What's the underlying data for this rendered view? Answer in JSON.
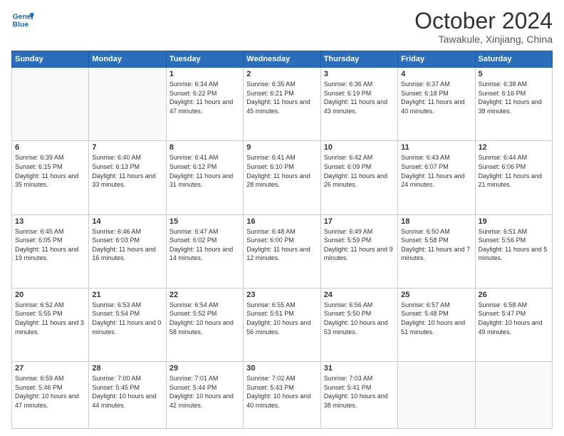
{
  "logo": {
    "line1": "General",
    "line2": "Blue"
  },
  "title": "October 2024",
  "subtitle": "Tawakule, Xinjiang, China",
  "weekdays": [
    "Sunday",
    "Monday",
    "Tuesday",
    "Wednesday",
    "Thursday",
    "Friday",
    "Saturday"
  ],
  "weeks": [
    [
      {
        "day": "",
        "info": ""
      },
      {
        "day": "",
        "info": ""
      },
      {
        "day": "1",
        "info": "Sunrise: 6:34 AM\nSunset: 6:22 PM\nDaylight: 11 hours and 47 minutes."
      },
      {
        "day": "2",
        "info": "Sunrise: 6:35 AM\nSunset: 6:21 PM\nDaylight: 11 hours and 45 minutes."
      },
      {
        "day": "3",
        "info": "Sunrise: 6:36 AM\nSunset: 6:19 PM\nDaylight: 11 hours and 43 minutes."
      },
      {
        "day": "4",
        "info": "Sunrise: 6:37 AM\nSunset: 6:18 PM\nDaylight: 11 hours and 40 minutes."
      },
      {
        "day": "5",
        "info": "Sunrise: 6:38 AM\nSunset: 6:16 PM\nDaylight: 11 hours and 38 minutes."
      }
    ],
    [
      {
        "day": "6",
        "info": "Sunrise: 6:39 AM\nSunset: 6:15 PM\nDaylight: 11 hours and 35 minutes."
      },
      {
        "day": "7",
        "info": "Sunrise: 6:40 AM\nSunset: 6:13 PM\nDaylight: 11 hours and 33 minutes."
      },
      {
        "day": "8",
        "info": "Sunrise: 6:41 AM\nSunset: 6:12 PM\nDaylight: 11 hours and 31 minutes."
      },
      {
        "day": "9",
        "info": "Sunrise: 6:41 AM\nSunset: 6:10 PM\nDaylight: 11 hours and 28 minutes."
      },
      {
        "day": "10",
        "info": "Sunrise: 6:42 AM\nSunset: 6:09 PM\nDaylight: 11 hours and 26 minutes."
      },
      {
        "day": "11",
        "info": "Sunrise: 6:43 AM\nSunset: 6:07 PM\nDaylight: 11 hours and 24 minutes."
      },
      {
        "day": "12",
        "info": "Sunrise: 6:44 AM\nSunset: 6:06 PM\nDaylight: 11 hours and 21 minutes."
      }
    ],
    [
      {
        "day": "13",
        "info": "Sunrise: 6:45 AM\nSunset: 6:05 PM\nDaylight: 11 hours and 19 minutes."
      },
      {
        "day": "14",
        "info": "Sunrise: 6:46 AM\nSunset: 6:03 PM\nDaylight: 11 hours and 16 minutes."
      },
      {
        "day": "15",
        "info": "Sunrise: 6:47 AM\nSunset: 6:02 PM\nDaylight: 11 hours and 14 minutes."
      },
      {
        "day": "16",
        "info": "Sunrise: 6:48 AM\nSunset: 6:00 PM\nDaylight: 11 hours and 12 minutes."
      },
      {
        "day": "17",
        "info": "Sunrise: 6:49 AM\nSunset: 5:59 PM\nDaylight: 11 hours and 9 minutes."
      },
      {
        "day": "18",
        "info": "Sunrise: 6:50 AM\nSunset: 5:58 PM\nDaylight: 11 hours and 7 minutes."
      },
      {
        "day": "19",
        "info": "Sunrise: 6:51 AM\nSunset: 5:56 PM\nDaylight: 11 hours and 5 minutes."
      }
    ],
    [
      {
        "day": "20",
        "info": "Sunrise: 6:52 AM\nSunset: 5:55 PM\nDaylight: 11 hours and 3 minutes."
      },
      {
        "day": "21",
        "info": "Sunrise: 6:53 AM\nSunset: 5:54 PM\nDaylight: 11 hours and 0 minutes."
      },
      {
        "day": "22",
        "info": "Sunrise: 6:54 AM\nSunset: 5:52 PM\nDaylight: 10 hours and 58 minutes."
      },
      {
        "day": "23",
        "info": "Sunrise: 6:55 AM\nSunset: 5:51 PM\nDaylight: 10 hours and 56 minutes."
      },
      {
        "day": "24",
        "info": "Sunrise: 6:56 AM\nSunset: 5:50 PM\nDaylight: 10 hours and 53 minutes."
      },
      {
        "day": "25",
        "info": "Sunrise: 6:57 AM\nSunset: 5:48 PM\nDaylight: 10 hours and 51 minutes."
      },
      {
        "day": "26",
        "info": "Sunrise: 6:58 AM\nSunset: 5:47 PM\nDaylight: 10 hours and 49 minutes."
      }
    ],
    [
      {
        "day": "27",
        "info": "Sunrise: 6:59 AM\nSunset: 5:46 PM\nDaylight: 10 hours and 47 minutes."
      },
      {
        "day": "28",
        "info": "Sunrise: 7:00 AM\nSunset: 5:45 PM\nDaylight: 10 hours and 44 minutes."
      },
      {
        "day": "29",
        "info": "Sunrise: 7:01 AM\nSunset: 5:44 PM\nDaylight: 10 hours and 42 minutes."
      },
      {
        "day": "30",
        "info": "Sunrise: 7:02 AM\nSunset: 5:43 PM\nDaylight: 10 hours and 40 minutes."
      },
      {
        "day": "31",
        "info": "Sunrise: 7:03 AM\nSunset: 5:41 PM\nDaylight: 10 hours and 38 minutes."
      },
      {
        "day": "",
        "info": ""
      },
      {
        "day": "",
        "info": ""
      }
    ]
  ]
}
